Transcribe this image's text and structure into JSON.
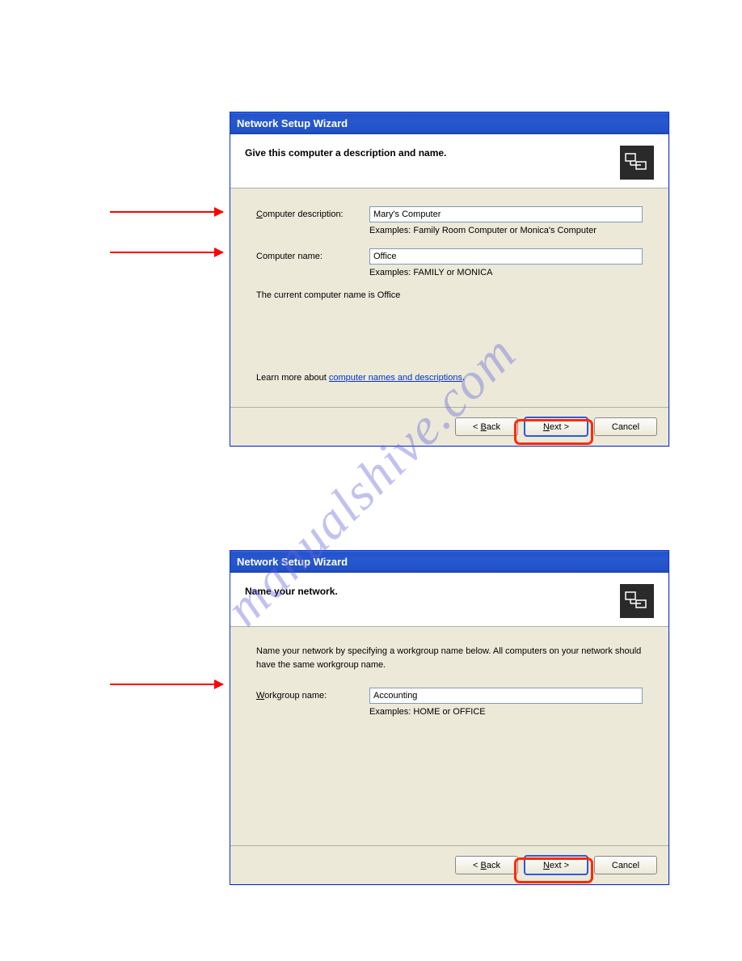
{
  "watermark": "manualshive.com",
  "dialog1": {
    "title": "Network Setup Wizard",
    "heading": "Give this computer a description and name.",
    "desc_label_pre": "C",
    "desc_label_post": "omputer description:",
    "desc_value": "Mary's Computer",
    "desc_example": "Examples: Family Room Computer or Monica's Computer",
    "name_label": "Computer name:",
    "name_value": "Office",
    "name_example": "Examples: FAMILY or MONICA",
    "current_name_text": "The current computer name is Office",
    "learn_more_pre": "Learn more about ",
    "learn_more_link": "computer names and descriptions",
    "learn_more_post": ".",
    "back_label": "< Back",
    "next_label": "Next >",
    "cancel_label": "Cancel"
  },
  "dialog2": {
    "title": "Network Setup Wizard",
    "heading": "Name your network.",
    "intro": "Name your network by specifying a workgroup name below. All computers on your network should have the same workgroup name.",
    "workgroup_label_pre": "W",
    "workgroup_label_post": "orkgroup name:",
    "workgroup_value": "Accounting",
    "workgroup_example": "Examples: HOME or OFFICE",
    "back_label": "< Back",
    "next_label": "Next >",
    "cancel_label": "Cancel"
  }
}
